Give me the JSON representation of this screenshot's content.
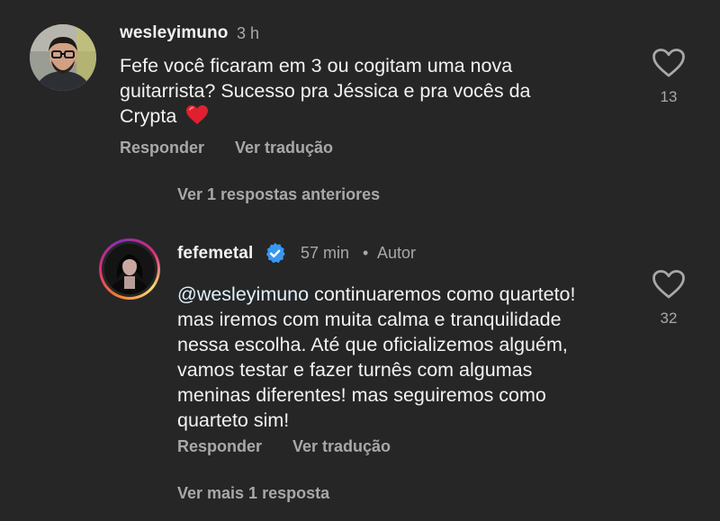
{
  "comment1": {
    "username": "wesleyimuno",
    "time": "3 h",
    "lines": [
      "Fefe você ficaram em 3 ou cogitam uma nova",
      "guitarrista? Sucesso pra Jéssica e pra vocês da",
      "Crypta"
    ],
    "emoji": "❤️",
    "likes": "13",
    "reply_label": "Responder",
    "translate_label": "Ver tradução"
  },
  "previous_replies_label": "Ver 1 respostas anteriores",
  "reply1": {
    "username": "fefemetal",
    "time": "57 min",
    "separator": "•",
    "author_badge": "Autor",
    "mention": "@wesleyimuno",
    "lines": [
      " continuaremos como quarteto!",
      "mas iremos com muita calma e tranquilidade",
      "nessa escolha. Até que oficializemos alguém,",
      "vamos testar e fazer turnês com algumas",
      "meninas diferentes! mas seguiremos como",
      "quarteto sim!"
    ],
    "likes": "32",
    "reply_label": "Responder",
    "translate_label": "Ver tradução"
  },
  "more_replies_label": "Ver mais 1 resposta",
  "colors": {
    "background": "#262626",
    "text": "#f2f2f2",
    "secondary": "#a8a8a8",
    "verified": "#3897f0"
  },
  "icons": {
    "like": "heart-outline-icon",
    "verified": "verified-badge-icon",
    "emoji": "red-heart-emoji"
  }
}
